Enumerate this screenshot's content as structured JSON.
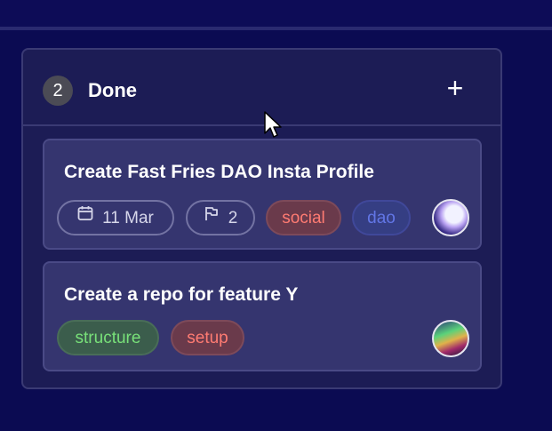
{
  "column": {
    "count": "2",
    "title": "Done",
    "add_label": "+"
  },
  "cards": [
    {
      "title": "Create Fast Fries DAO Insta Profile",
      "date": "11 Mar",
      "subtasks": "2",
      "tags": [
        "social",
        "dao"
      ]
    },
    {
      "title": "Create a repo for feature Y",
      "tags": [
        "structure",
        "setup"
      ]
    }
  ],
  "colors": {
    "background": "#0b0b52",
    "column": "#1c1c55",
    "card": "#35356f",
    "social": "#ff7b72",
    "dao": "#6276e6",
    "structure": "#78e079",
    "setup": "#ff7b72"
  },
  "icons": {
    "date": "calendar-icon",
    "subtasks": "flag-icon",
    "add": "plus-icon"
  }
}
